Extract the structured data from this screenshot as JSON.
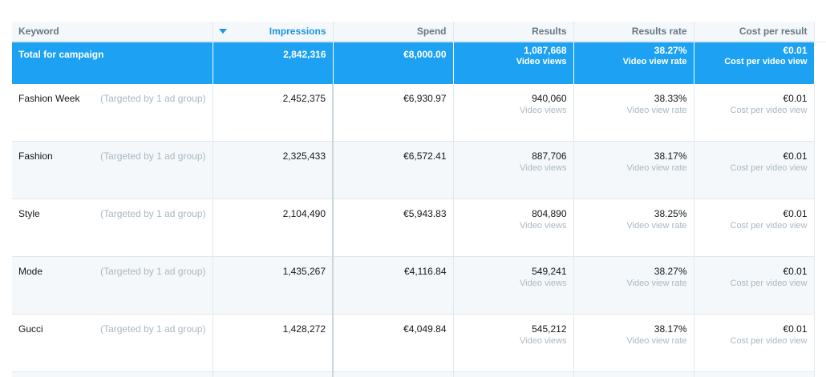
{
  "columns": {
    "keyword": "Keyword",
    "impressions": "Impressions",
    "spend": "Spend",
    "results": "Results",
    "results_rate": "Results rate",
    "cost_per_result": "Cost per result"
  },
  "total": {
    "label": "Total for campaign",
    "impressions": "2,842,316",
    "spend": "€8,000.00",
    "results": "1,087,668",
    "results_sub": "Video views",
    "results_rate": "38.27%",
    "results_rate_sub": "Video view rate",
    "cost": "€0.01",
    "cost_sub": "Cost per video view"
  },
  "rows": [
    {
      "keyword": "Fashion Week",
      "target": "(Targeted by 1 ad group)",
      "impressions": "2,452,375",
      "spend": "€6,930.97",
      "results": "940,060",
      "results_sub": "Video views",
      "rate": "38.33%",
      "rate_sub": "Video view rate",
      "cost": "€0.01",
      "cost_sub": "Cost per video view"
    },
    {
      "keyword": "Fashion",
      "target": "(Targeted by 1 ad group)",
      "impressions": "2,325,433",
      "spend": "€6,572.41",
      "results": "887,706",
      "results_sub": "Video views",
      "rate": "38.17%",
      "rate_sub": "Video view rate",
      "cost": "€0.01",
      "cost_sub": "Cost per video view"
    },
    {
      "keyword": "Style",
      "target": "(Targeted by 1 ad group)",
      "impressions": "2,104,490",
      "spend": "€5,943.83",
      "results": "804,890",
      "results_sub": "Video views",
      "rate": "38.25%",
      "rate_sub": "Video view rate",
      "cost": "€0.01",
      "cost_sub": "Cost per video view"
    },
    {
      "keyword": "Mode",
      "target": "(Targeted by 1 ad group)",
      "impressions": "1,435,267",
      "spend": "€4,116.84",
      "results": "549,241",
      "results_sub": "Video views",
      "rate": "38.27%",
      "rate_sub": "Video view rate",
      "cost": "€0.01",
      "cost_sub": "Cost per video view"
    },
    {
      "keyword": "Gucci",
      "target": "(Targeted by 1 ad group)",
      "impressions": "1,428,272",
      "spend": "€4,049.84",
      "results": "545,212",
      "results_sub": "Video views",
      "rate": "38.17%",
      "rate_sub": "Video view rate",
      "cost": "€0.01",
      "cost_sub": "Cost per video view"
    }
  ],
  "colors": {
    "accent": "#1da1f2",
    "sorted_header": "#1b95e0",
    "muted": "#aab8c2"
  },
  "sort": {
    "column": "impressions",
    "direction": "descending",
    "icon": "caret-down-icon"
  }
}
